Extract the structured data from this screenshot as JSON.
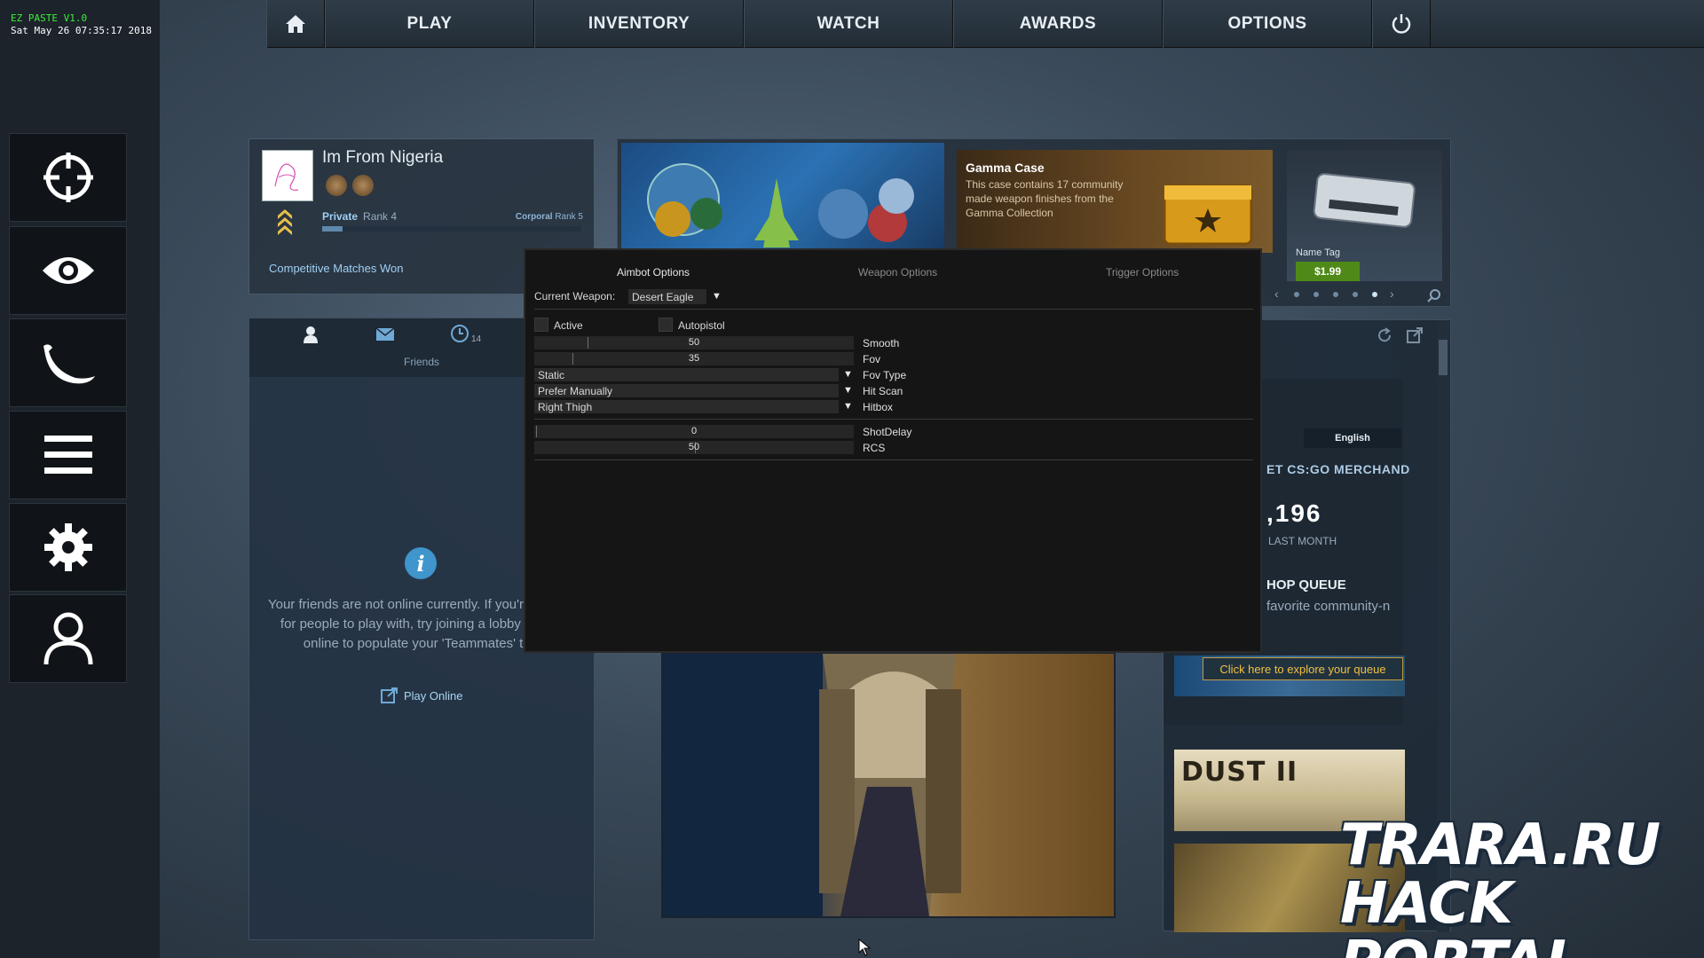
{
  "overlay": {
    "title": "EZ PASTE V1.0",
    "datetime": "Sat May 26 07:35:17 2018"
  },
  "topnav": {
    "items": [
      "PLAY",
      "INVENTORY",
      "WATCH",
      "AWARDS",
      "OPTIONS"
    ]
  },
  "sidebar": {
    "icons": [
      "crosshair-icon",
      "eye-icon",
      "knife-icon",
      "menu-icon",
      "gear-icon",
      "user-icon"
    ]
  },
  "profile": {
    "name": "Im From Nigeria",
    "rank_name": "Private",
    "rank_level": "Rank 4",
    "next_rank_name": "Corporal",
    "next_rank_level": "Rank 5",
    "xp_progress": 0.08,
    "comp_matches": "Competitive Matches Won"
  },
  "friends": {
    "label": "Friends",
    "history_count": "14",
    "message": "Your friends are not online currently. If you're looking for people to play with, try joining a lobby or play online to populate your 'Teammates' tab.",
    "play_online": "Play Online"
  },
  "banners": {
    "case_title": "Gamma Case",
    "case_desc": "This case contains 17 community made weapon finishes from the Gamma Collection",
    "nametag_label": "Name Tag",
    "nametag_price": "$1.99"
  },
  "news": {
    "language": "English",
    "merch": "ET CS:GO MERCHAND",
    "number": ",196",
    "last_month": "LAST MONTH",
    "shop_queue": "HOP QUEUE",
    "favorite": "favorite community-n",
    "explore": "Click here to explore your queue",
    "map_title": "DUST II"
  },
  "cheat": {
    "tabs": [
      "Aimbot Options",
      "Weapon Options",
      "Trigger Options"
    ],
    "current_weapon_label": "Current Weapon:",
    "current_weapon": "Desert Eagle",
    "active_label": "Active",
    "autopistol_label": "Autopistol",
    "smooth_value": "50",
    "smooth_label": "Smooth",
    "fov_value": "35",
    "fov_label": "Fov",
    "fov_type_value": "Static",
    "fov_type_label": "Fov Type",
    "hit_scan_value": "Prefer Manually",
    "hit_scan_label": "Hit Scan",
    "hitbox_value": "Right Thigh",
    "hitbox_label": "Hitbox",
    "shotdelay_value": "0",
    "shotdelay_label": "ShotDelay",
    "rcs_value": "50",
    "rcs_label": "RCS"
  },
  "watermark": {
    "line1": "TRARA.RU",
    "line2": "HACK PORTAL"
  },
  "colors": {
    "accent": "#9ed0f4",
    "ez_green": "#3cf03c",
    "price_green": "#4f8a18"
  }
}
